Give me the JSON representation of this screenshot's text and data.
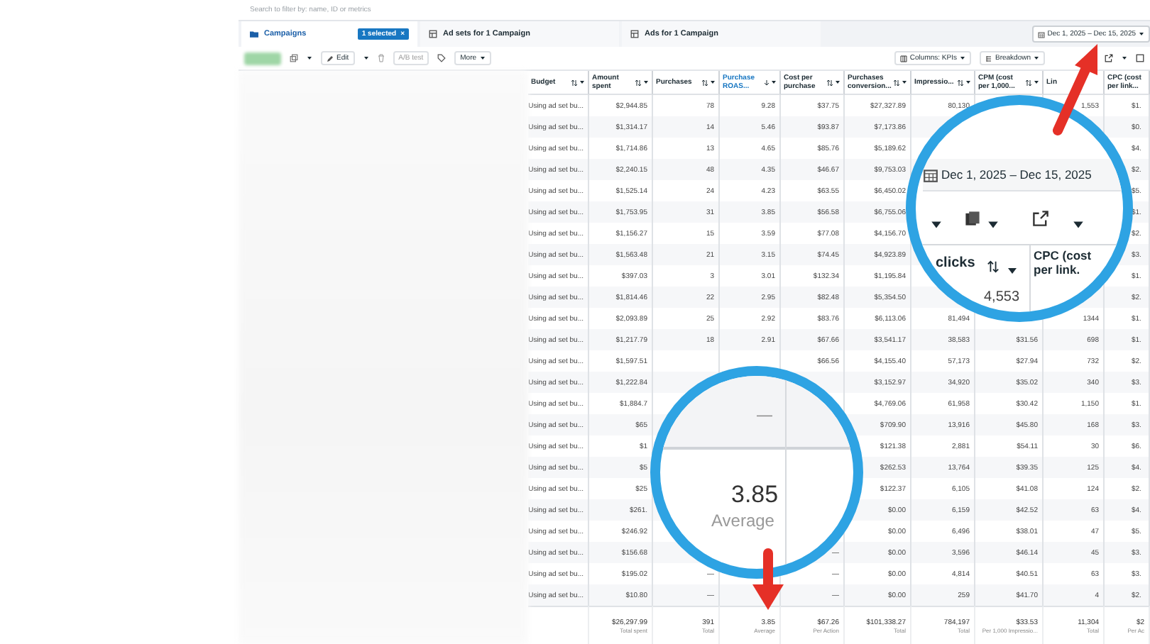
{
  "search": {
    "placeholder": "Search to filter by: name, ID or metrics"
  },
  "tabs": [
    {
      "label": "Campaigns",
      "selected": true,
      "badge": "1 selected",
      "badge_close": "×"
    },
    {
      "label": "Ad sets for 1 Campaign",
      "selected": false
    },
    {
      "label": "Ads for 1 Campaign",
      "selected": false
    }
  ],
  "date_range": "Dec 1, 2025 – Dec 15, 2025",
  "toolbar": {
    "edit": "Edit",
    "ab_test": "A/B test",
    "more": "More",
    "columns": "Columns: KPIs",
    "breakdown": "Breakdown"
  },
  "table": {
    "columns": [
      {
        "label": "Budget",
        "sorted": false
      },
      {
        "label": "Amount spent",
        "sorted": false
      },
      {
        "label": "Purchases",
        "sorted": false
      },
      {
        "label": "Purchase ROAS...",
        "sorted": true
      },
      {
        "label": "Cost per purchase",
        "sorted": false
      },
      {
        "label": "Purchases conversion...",
        "sorted": false
      },
      {
        "label": "Impressio...",
        "sorted": false
      },
      {
        "label": "CPM (cost per 1,000...",
        "sorted": false
      },
      {
        "label": "Lin",
        "sorted": false
      },
      {
        "label": "CPC (cost per link...",
        "sorted": false
      }
    ],
    "rows": [
      [
        "Using ad set bu...",
        "$2,944.85",
        "78",
        "9.28",
        "$37.75",
        "$27,327.89",
        "80,130",
        null,
        "1,553",
        "$1."
      ],
      [
        "Using ad set bu...",
        "$1,314.17",
        "14",
        "5.46",
        "$93.87",
        "$7,173.86",
        null,
        null,
        null,
        "$0."
      ],
      [
        "Using ad set bu...",
        "$1,714.86",
        "13",
        "4.65",
        "$85.76",
        "$5,189.62",
        null,
        null,
        null,
        "$4."
      ],
      [
        "Using ad set bu...",
        "$2,240.15",
        "48",
        "4.35",
        "$46.67",
        "$9,753.03",
        null,
        null,
        null,
        "$2."
      ],
      [
        "Using ad set bu...",
        "$1,525.14",
        "24",
        "4.23",
        "$63.55",
        "$6,450.02",
        null,
        null,
        null,
        "$5."
      ],
      [
        "Using ad set bu...",
        "$1,753.95",
        "31",
        "3.85",
        "$56.58",
        "$6,755.06",
        null,
        null,
        null,
        "$1."
      ],
      [
        "Using ad set bu...",
        "$1,156.27",
        "15",
        "3.59",
        "$77.08",
        "$4,156.70",
        null,
        null,
        null,
        "$2."
      ],
      [
        "Using ad set bu...",
        "$1,563.48",
        "21",
        "3.15",
        "$74.45",
        "$4,923.89",
        null,
        null,
        null,
        "$3."
      ],
      [
        "Using ad set bu...",
        "$397.03",
        "3",
        "3.01",
        "$132.34",
        "$1,195.84",
        null,
        null,
        null,
        "$1."
      ],
      [
        "Using ad set bu...",
        "$1,814.46",
        "22",
        "2.95",
        "$82.48",
        "$5,354.50",
        null,
        null,
        null,
        "$2."
      ],
      [
        "Using ad set bu...",
        "$2,093.89",
        "25",
        "2.92",
        "$83.76",
        "$6,113.06",
        "81,494",
        null,
        "1344",
        "$1."
      ],
      [
        "Using ad set bu...",
        "$1,217.79",
        "18",
        "2.91",
        "$67.66",
        "$3,541.17",
        "38,583",
        "$31.56",
        "698",
        "$1."
      ],
      [
        "Using ad set bu...",
        "$1,597.51",
        null,
        null,
        "$66.56",
        "$4,155.40",
        "57,173",
        "$27.94",
        "732",
        "$2."
      ],
      [
        "Using ad set bu...",
        "$1,222.84",
        null,
        null,
        null,
        "$3,152.97",
        "34,920",
        "$35.02",
        "340",
        "$3."
      ],
      [
        "Using ad set bu...",
        "$1,884.7",
        null,
        null,
        null,
        "$4,769.06",
        "61,958",
        "$30.42",
        "1,150",
        "$1."
      ],
      [
        "Using ad set bu...",
        "$65",
        null,
        null,
        null,
        "$709.90",
        "13,916",
        "$45.80",
        "168",
        "$3."
      ],
      [
        "Using ad set bu...",
        "$1",
        null,
        null,
        null,
        "$121.38",
        "2,881",
        "$54.11",
        "30",
        "$6."
      ],
      [
        "Using ad set bu...",
        "$5",
        null,
        null,
        null,
        "$262.53",
        "13,764",
        "$39.35",
        "125",
        "$4."
      ],
      [
        "Using ad set bu...",
        "$25",
        null,
        null,
        null,
        "$122.37",
        "6,105",
        "$41.08",
        "124",
        "$2."
      ],
      [
        "Using ad set bu...",
        "$261.",
        null,
        null,
        null,
        "$0.00",
        "6,159",
        "$42.52",
        "63",
        "$4."
      ],
      [
        "Using ad set bu...",
        "$246.92",
        null,
        null,
        null,
        "$0.00",
        "6,496",
        "$38.01",
        "47",
        "$5."
      ],
      [
        "Using ad set bu...",
        "$156.68",
        null,
        null,
        "—",
        "$0.00",
        "3,596",
        "$46.14",
        "45",
        "$3."
      ],
      [
        "Using ad set bu...",
        "$195.02",
        "—",
        null,
        "—",
        "$0.00",
        "4,814",
        "$40.51",
        "63",
        "$3."
      ],
      [
        "Using ad set bu...",
        "$10.80",
        "—",
        null,
        "—",
        "$0.00",
        "259",
        "$41.70",
        "4",
        "$2."
      ]
    ],
    "totals": [
      {
        "value": "$26,297.99",
        "label": "Total spent"
      },
      {
        "value": "391",
        "label": "Total"
      },
      {
        "value": "3.85",
        "label": "Average"
      },
      {
        "value": "$67.26",
        "label": "Per Action"
      },
      {
        "value": "$101,338.27",
        "label": "Total"
      },
      {
        "value": "784,197",
        "label": "Total"
      },
      {
        "value": "$33.53",
        "label": "Per 1,000 Impressio..."
      },
      {
        "value": "11,304",
        "label": "Total"
      },
      {
        "value": "$2",
        "label": "Per Ac"
      }
    ]
  },
  "magnifiers": [
    {
      "kind": "toolbar",
      "date_range": "Dec 1, 2025 – Dec 15, 2025",
      "column": "clicks",
      "next_column": "CPC (cost per link.",
      "cell": "4,553"
    },
    {
      "kind": "total",
      "cell": "—",
      "value": "3.85",
      "label": "Average"
    }
  ]
}
